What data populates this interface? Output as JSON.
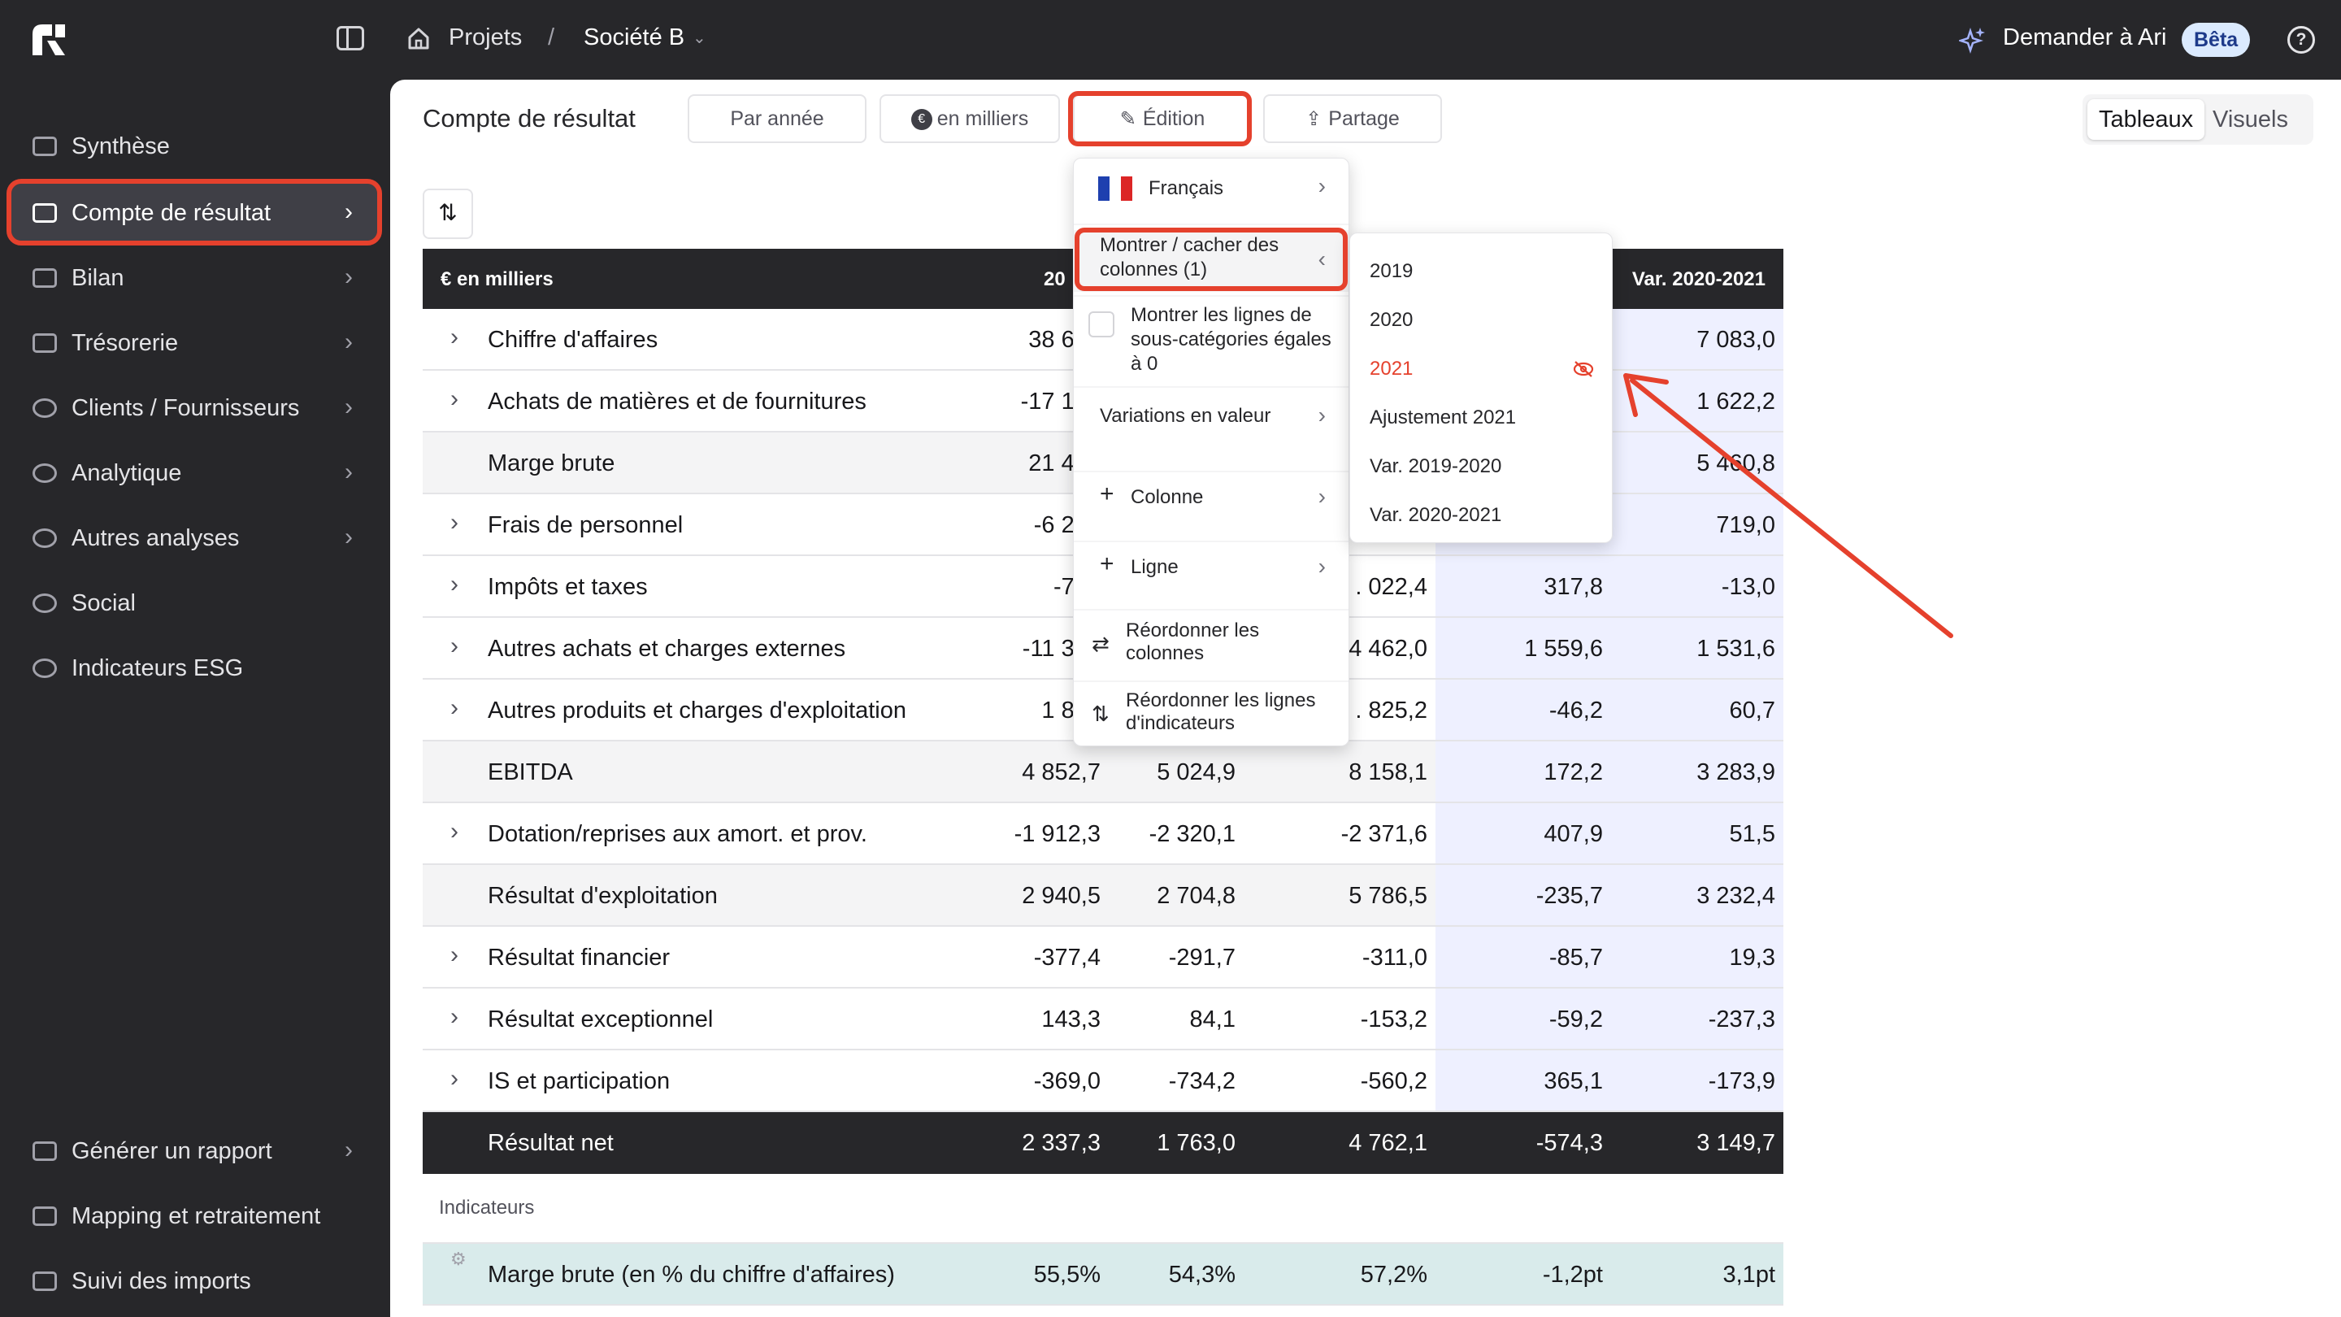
{
  "breadcrumb": {
    "home": "Projets",
    "sep": "/",
    "company": "Société B"
  },
  "header": {
    "ask": "Demander à Ari",
    "beta": "Bêta",
    "help": "?"
  },
  "sidebar": {
    "items": [
      {
        "label": "Synthèse"
      },
      {
        "label": "Compte de résultat"
      },
      {
        "label": "Bilan"
      },
      {
        "label": "Trésorerie"
      },
      {
        "label": "Clients / Fournisseurs"
      },
      {
        "label": "Analytique"
      },
      {
        "label": "Autres analyses"
      },
      {
        "label": "Social"
      },
      {
        "label": "Indicateurs ESG"
      }
    ],
    "bottom": [
      {
        "label": "Générer un rapport"
      },
      {
        "label": "Mapping et retraitement"
      },
      {
        "label": "Suivi des imports"
      }
    ]
  },
  "toolbar": {
    "title": "Compte de résultat",
    "period": "Par année",
    "unit_icon": "€",
    "unit": "en milliers",
    "edit": "Édition",
    "share": "Partage",
    "tab_tables": "Tableaux",
    "tab_visuals": "Visuels"
  },
  "table": {
    "header": {
      "label": "€ en milliers",
      "c1": "20",
      "c5": "Var. 2020-2021"
    },
    "rows": [
      {
        "label": "Chiffre d'affaires",
        "v1": "38 602",
        "v2": "",
        "v3": "",
        "v4": "",
        "v5": "7 083,0",
        "type": "exp"
      },
      {
        "label": "Achats de matières et de fournitures",
        "v1": "-17 172",
        "v2": "",
        "v3": "",
        "v4": "",
        "v5": "1 622,2",
        "type": "exp"
      },
      {
        "label": "Marge brute",
        "v1": "21 430",
        "v2": "",
        "v3": "",
        "v4": "",
        "v5": "5 460,8",
        "type": "sub"
      },
      {
        "label": "Frais de personnel",
        "v1": "-6 299",
        "v2": "",
        "v3": "",
        "v4": "",
        "v5": "719,0",
        "type": "exp"
      },
      {
        "label": "Impôts et taxes",
        "v1": "-717",
        "v2": "",
        "v3": ". 022,4",
        "v4": "317,8",
        "v5": "-13,0",
        "type": "exp"
      },
      {
        "label": "Autres achats et charges externes",
        "v1": "-11 370",
        "v2": "",
        "v3": "4 462,0",
        "v4": "1 559,6",
        "v5": "1 531,6",
        "type": "exp"
      },
      {
        "label": "Autres produits et charges d'exploitation",
        "v1": "1 810",
        "v2": "",
        "v3": ". 825,2",
        "v4": "-46,2",
        "v5": "60,7",
        "type": "exp"
      },
      {
        "label": "EBITDA",
        "v1": "4 852,7",
        "v2": "5 024,9",
        "v3": "8 158,1",
        "v4": "172,2",
        "v5": "3 283,9",
        "type": "sub"
      },
      {
        "label": "Dotation/reprises aux amort. et prov.",
        "v1": "-1 912,3",
        "v2": "-2 320,1",
        "v3": "-2 371,6",
        "v4": "407,9",
        "v5": "51,5",
        "type": "exp"
      },
      {
        "label": "Résultat d'exploitation",
        "v1": "2 940,5",
        "v2": "2 704,8",
        "v3": "5 786,5",
        "v4": "-235,7",
        "v5": "3 232,4",
        "type": "sub"
      },
      {
        "label": "Résultat financier",
        "v1": "-377,4",
        "v2": "-291,7",
        "v3": "-311,0",
        "v4": "-85,7",
        "v5": "19,3",
        "type": "exp"
      },
      {
        "label": "Résultat exceptionnel",
        "v1": "143,3",
        "v2": "84,1",
        "v3": "-153,2",
        "v4": "-59,2",
        "v5": "-237,3",
        "type": "exp"
      },
      {
        "label": "IS et participation",
        "v1": "-369,0",
        "v2": "-734,2",
        "v3": "-560,2",
        "v4": "365,1",
        "v5": "-173,9",
        "type": "exp"
      },
      {
        "label": "Résultat net",
        "v1": "2 337,3",
        "v2": "1 763,0",
        "v3": "4 762,1",
        "v4": "-574,3",
        "v5": "3 149,7",
        "type": "net"
      }
    ],
    "indicators_label": "Indicateurs",
    "indicator": {
      "label": "Marge brute (en % du chiffre d'affaires)",
      "v1": "55,5%",
      "v2": "54,3%",
      "v3": "57,2%",
      "v4": "-1,2pt",
      "v5": "3,1pt"
    }
  },
  "edit_menu": {
    "language": "Français",
    "columns_l1": "Montrer / cacher des",
    "columns_l2": "colonnes (1)",
    "subcat_l1": "Montrer les lignes de",
    "subcat_l2": "sous-catégories égales",
    "subcat_l3": "à 0",
    "variations": "Variations en valeur",
    "add_column": "Colonne",
    "add_row": "Ligne",
    "reorder_cols_l1": "Réordonner les",
    "reorder_cols_l2": "colonnes",
    "reorder_rows_l1": "Réordonner les lignes",
    "reorder_rows_l2": "d'indicateurs"
  },
  "columns_menu": {
    "items": [
      "2019",
      "2020",
      "2021",
      "Ajustement 2021",
      "Var. 2019-2020",
      "Var. 2020-2021"
    ],
    "hidden_color": "#e5412d"
  },
  "colors": {
    "accent": "#e5412d",
    "dark": "#27272a",
    "variation_bg": "#eef0ff",
    "indicator_bg": "#d9ebeb"
  }
}
